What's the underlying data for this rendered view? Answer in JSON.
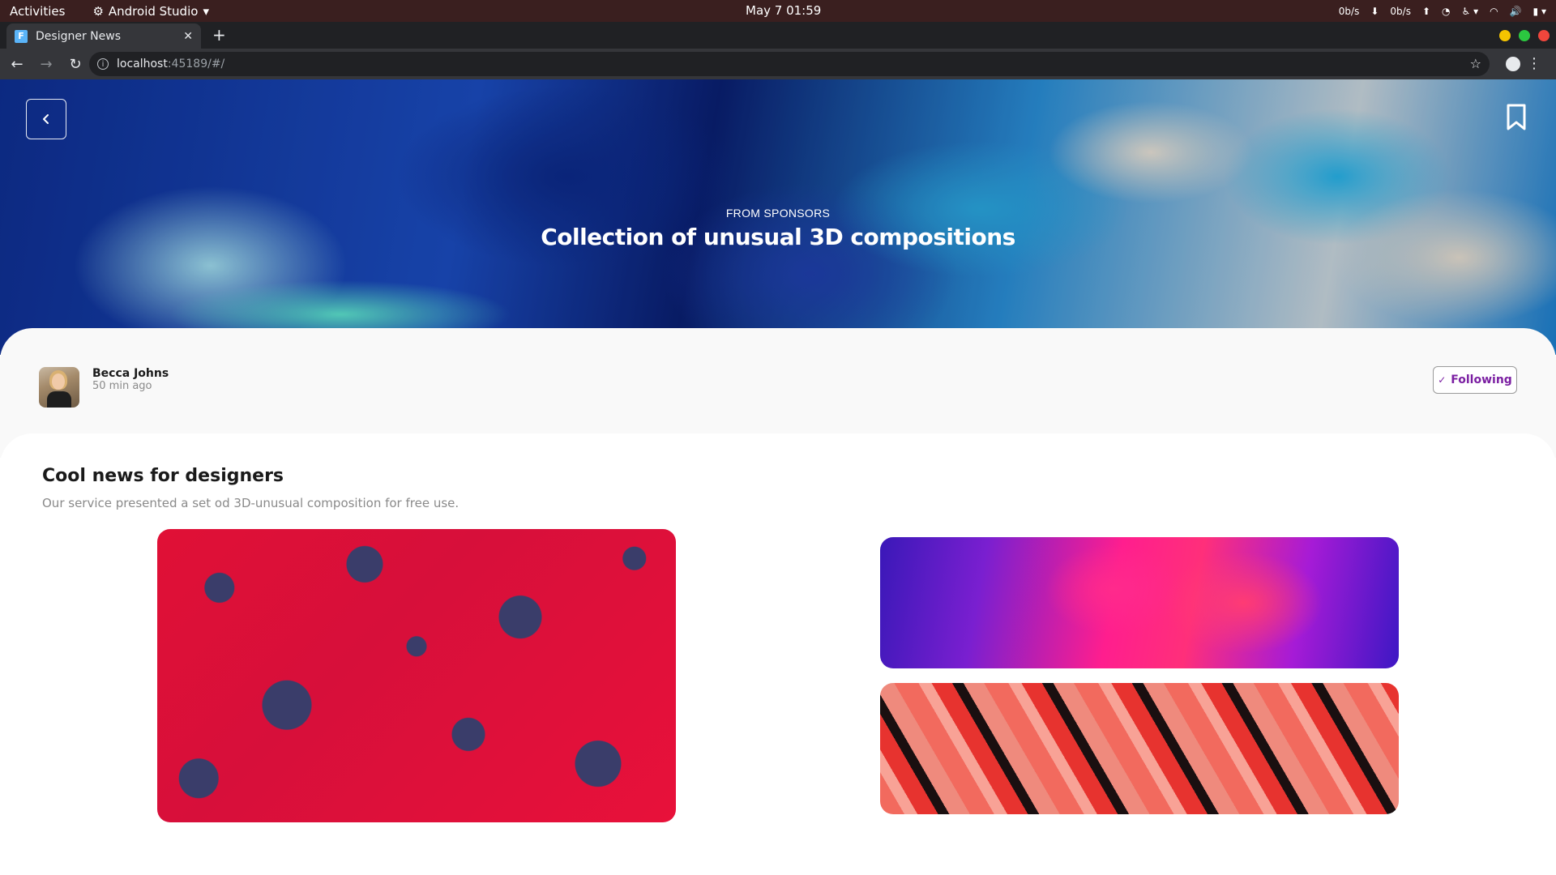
{
  "system_bar": {
    "activities": "Activities",
    "app_name": "Android Studio",
    "datetime": "May 7  01:59",
    "net_down": "0b/s",
    "net_up": "0b/s"
  },
  "browser": {
    "tab_title": "Designer News",
    "url_host": "localhost",
    "url_rest": ":45189/#/"
  },
  "hero": {
    "eyebrow": "FROM SPONSORS",
    "title": "Collection of unusual 3D compositions"
  },
  "author": {
    "name": "Becca Johns",
    "time_ago": "50 min ago",
    "follow_label": "Following"
  },
  "content": {
    "title": "Cool news for designers",
    "description": "Our service presented a set od 3D-unusual composition for free use."
  },
  "colors": {
    "follow_accent": "#7b1fa2",
    "system_bar": "#3a1f1f"
  },
  "icons": {
    "back": "chevron-left-icon",
    "bookmark": "bookmark-icon",
    "check": "check-icon"
  }
}
